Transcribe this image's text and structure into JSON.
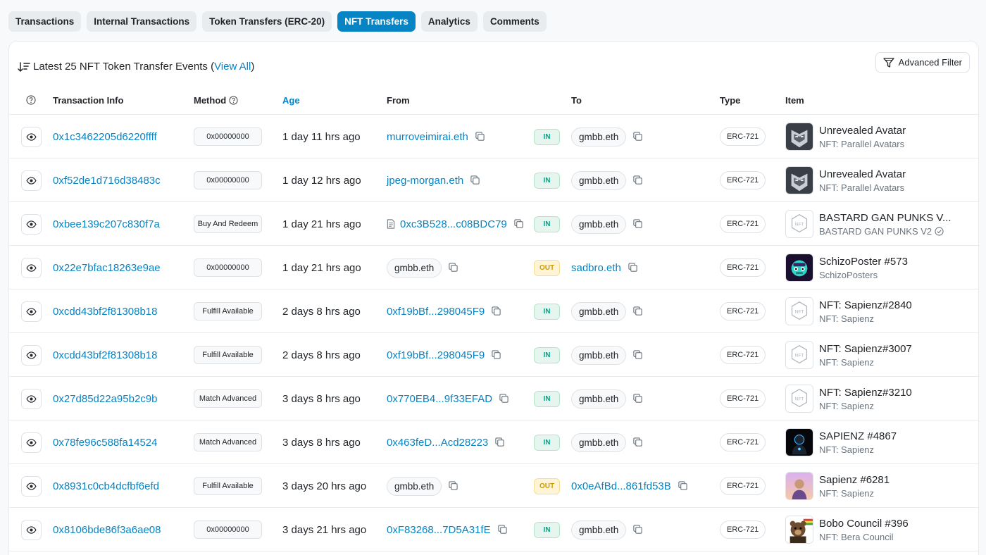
{
  "tabs": [
    {
      "label": "Transactions",
      "active": false
    },
    {
      "label": "Internal Transactions",
      "active": false
    },
    {
      "label": "Token Transfers (ERC-20)",
      "active": false
    },
    {
      "label": "NFT Transfers",
      "active": true
    },
    {
      "label": "Analytics",
      "active": false
    },
    {
      "label": "Comments",
      "active": false
    }
  ],
  "card": {
    "title_prefix": "Latest 25 NFT Token Transfer Events (",
    "view_all": "View All",
    "title_suffix": ")",
    "advanced_filter": "Advanced Filter"
  },
  "columns": {
    "tx_info": "Transaction Info",
    "method": "Method",
    "age": "Age",
    "from": "From",
    "to": "To",
    "type": "Type",
    "item": "Item"
  },
  "rows": [
    {
      "tx": "0x1c3462205d6220ffff",
      "method": "0x00000000",
      "age": "1 day 11 hrs ago",
      "from": "murroveimirai.eth",
      "from_style": "link",
      "dir": "IN",
      "to": "gmbb.eth",
      "to_style": "pill",
      "type": "ERC-721",
      "item_name": "Unrevealed Avatar",
      "item_coll": "NFT: Parallel Avatars",
      "img": "avatar"
    },
    {
      "tx": "0xf52de1d716d38483c",
      "method": "0x00000000",
      "age": "1 day 12 hrs ago",
      "from": "jpeg-morgan.eth",
      "from_style": "link",
      "dir": "IN",
      "to": "gmbb.eth",
      "to_style": "pill",
      "type": "ERC-721",
      "item_name": "Unrevealed Avatar",
      "item_coll": "NFT: Parallel Avatars",
      "img": "avatar"
    },
    {
      "tx": "0xbee139c207c830f7a",
      "method": "Buy And Redeem",
      "age": "1 day 21 hrs ago",
      "from": "0xc3B528...c08BDC79",
      "from_style": "contract",
      "dir": "IN",
      "to": "gmbb.eth",
      "to_style": "pill",
      "type": "ERC-721",
      "item_name": "BASTARD GAN PUNKS V...",
      "item_coll": "BASTARD GAN PUNKS V2",
      "img": "placeholder",
      "verified": true
    },
    {
      "tx": "0x22e7bfac18263e9ae",
      "method": "0x00000000",
      "age": "1 day 21 hrs ago",
      "from": "gmbb.eth",
      "from_style": "pill",
      "dir": "OUT",
      "to": "sadbro.eth",
      "to_style": "link",
      "type": "ERC-721",
      "item_name": "SchizoPoster #573",
      "item_coll": "SchizoPosters",
      "img": "schizo"
    },
    {
      "tx": "0xcdd43bf2f81308b18",
      "method": "Fulfill Available",
      "age": "2 days 8 hrs ago",
      "from": "0xf19bBf...298045F9",
      "from_style": "link",
      "dir": "IN",
      "to": "gmbb.eth",
      "to_style": "pill",
      "type": "ERC-721",
      "item_name": "NFT: Sapienz#2840",
      "item_coll": "NFT: Sapienz",
      "img": "placeholder"
    },
    {
      "tx": "0xcdd43bf2f81308b18",
      "method": "Fulfill Available",
      "age": "2 days 8 hrs ago",
      "from": "0xf19bBf...298045F9",
      "from_style": "link",
      "dir": "IN",
      "to": "gmbb.eth",
      "to_style": "pill",
      "type": "ERC-721",
      "item_name": "NFT: Sapienz#3007",
      "item_coll": "NFT: Sapienz",
      "img": "placeholder"
    },
    {
      "tx": "0x27d85d22a95b2c9b",
      "method": "Match Advanced",
      "age": "3 days 8 hrs ago",
      "from": "0x770EB4...9f33EFAD",
      "from_style": "link",
      "dir": "IN",
      "to": "gmbb.eth",
      "to_style": "pill",
      "type": "ERC-721",
      "item_name": "NFT: Sapienz#3210",
      "item_coll": "NFT: Sapienz",
      "img": "placeholder"
    },
    {
      "tx": "0x78fe96c588fa14524",
      "method": "Match Advanced",
      "age": "3 days 8 hrs ago",
      "from": "0x463feD...Acd28223",
      "from_style": "link",
      "dir": "IN",
      "to": "gmbb.eth",
      "to_style": "pill",
      "type": "ERC-721",
      "item_name": "SAPIENZ #4867",
      "item_coll": "NFT: Sapienz",
      "img": "sapienz-dark"
    },
    {
      "tx": "0x8931c0cb4dcfbf6efd",
      "method": "Fulfill Available",
      "age": "3 days 20 hrs ago",
      "from": "gmbb.eth",
      "from_style": "pill",
      "dir": "OUT",
      "to": "0x0eAfBd...861fd53B",
      "to_style": "link",
      "type": "ERC-721",
      "item_name": "Sapienz #6281",
      "item_coll": "NFT: Sapienz",
      "img": "sapienz-pink"
    },
    {
      "tx": "0x8106bde86f3a6ae08",
      "method": "0x00000000",
      "age": "3 days 21 hrs ago",
      "from": "0xF83268...7D5A31fE",
      "from_style": "link",
      "dir": "IN",
      "to": "gmbb.eth",
      "to_style": "pill",
      "type": "ERC-721",
      "item_name": "Bobo Council #396",
      "item_coll": "NFT: Bera Council",
      "img": "bobo"
    }
  ],
  "colors": {
    "accent": "#0784c3",
    "in_text": "#00a186",
    "out_text": "#cc9a06"
  }
}
